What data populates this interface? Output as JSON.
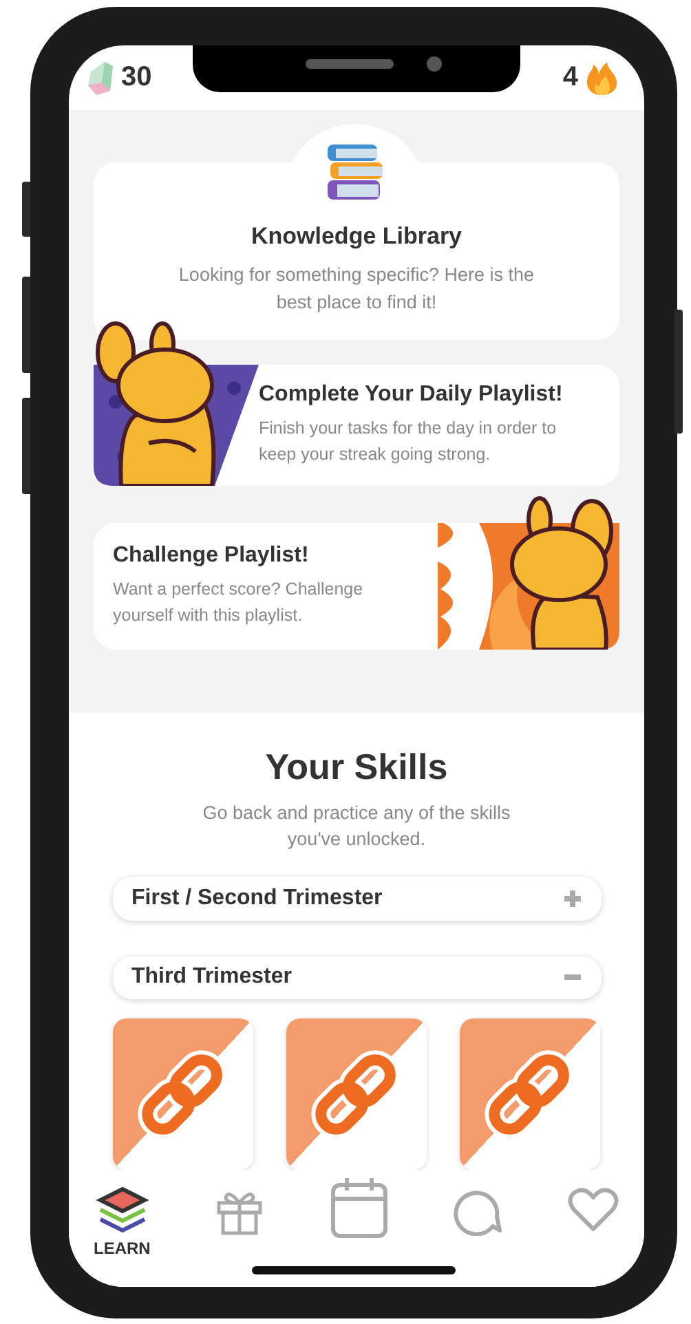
{
  "status": {
    "gems": "30",
    "streak": "4"
  },
  "library": {
    "title": "Knowledge Library",
    "description": "Looking for something specific? Here is the best place to find it!"
  },
  "playlists": [
    {
      "kind": "daily",
      "title": "Complete Your Daily Playlist!",
      "description": "Finish your tasks for the day in order to keep your streak going strong."
    },
    {
      "kind": "challenge",
      "title": "Challenge Playlist!",
      "description": "Want a perfect score? Challenge yourself with this playlist."
    }
  ],
  "skills": {
    "title": "Your Skills",
    "subtitle": "Go back and practice any of the skills you've unlocked.",
    "sections": [
      {
        "label": "First / Second Trimester",
        "expanded": false
      },
      {
        "label": "Third Trimester",
        "expanded": true,
        "tiles": [
          {
            "kind": "link"
          },
          {
            "kind": "link"
          },
          {
            "kind": "link"
          }
        ]
      }
    ]
  },
  "tabs": [
    {
      "kind": "learn",
      "label": "LEARN",
      "selected": true
    },
    {
      "kind": "gift",
      "selected": false
    },
    {
      "kind": "calendar",
      "selected": false
    },
    {
      "kind": "chat",
      "selected": false
    },
    {
      "kind": "heart",
      "selected": false
    }
  ]
}
